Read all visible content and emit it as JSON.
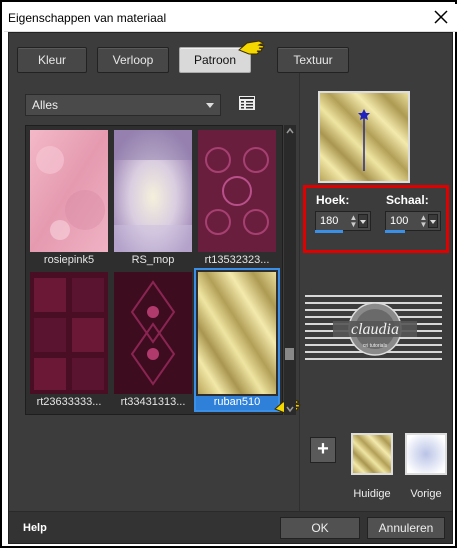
{
  "window": {
    "title": "Eigenschappen van materiaal"
  },
  "tabs": [
    {
      "label": "Kleur",
      "active": false
    },
    {
      "label": "Verloop",
      "active": false
    },
    {
      "label": "Patroon",
      "active": true
    },
    {
      "label": "Textuur",
      "active": false
    }
  ],
  "category": {
    "selected": "Alles"
  },
  "patterns": [
    {
      "label": "rosiepink5",
      "selected": false
    },
    {
      "label": "RS_mop",
      "selected": false
    },
    {
      "label": "rt13532323...",
      "selected": false
    },
    {
      "label": "rt23633333...",
      "selected": false
    },
    {
      "label": "rt33431313...",
      "selected": false
    },
    {
      "label": "ruban510",
      "selected": true
    }
  ],
  "params": {
    "angle_label": "Hoek:",
    "angle_value": "180",
    "scale_label": "Schaal:",
    "scale_value": "100"
  },
  "swatches": {
    "current_label": "Huidige",
    "previous_label": "Vorige"
  },
  "watermark": {
    "text": "claudia",
    "subtext": "cri tutorials"
  },
  "footer": {
    "help": "Help",
    "ok": "OK",
    "cancel": "Annuleren"
  },
  "colors": {
    "accent": "#3a8fe6",
    "highlight_border": "#e00000",
    "dialog_bg": "#3c3c3c"
  }
}
